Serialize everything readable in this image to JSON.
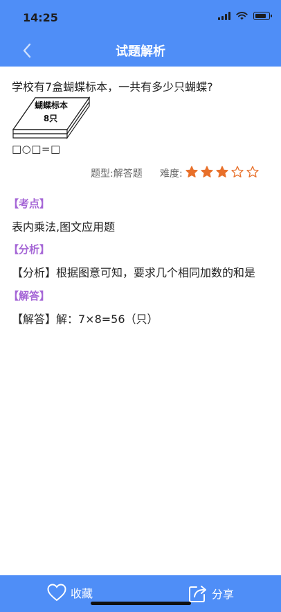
{
  "status_bar": {
    "time": "14:25"
  },
  "header": {
    "title": "试题解析"
  },
  "question": {
    "text": "学校有7盒蝴蝶标本，一共有多少只蝴蝶?",
    "image_text_line1": "蝴蝶标本",
    "image_text_line2": "8只",
    "equation": "□○□=□"
  },
  "meta": {
    "type_label": "题型:解答题",
    "difficulty_label": "难度:",
    "difficulty_rating": 3,
    "difficulty_max": 5,
    "star_color": "#e8702a"
  },
  "sections": {
    "kaodian_title": "【考点】",
    "kaodian_body": "表内乘法,图文应用题",
    "fenxi_title": "【分析】",
    "fenxi_body": "【分析】根据图意可知，要求几个相同加数的和是",
    "jieda_title": "【解答】",
    "jieda_body": "【解答】解：7×8=56（只）"
  },
  "bottom_bar": {
    "favorite_label": "收藏",
    "share_label": "分享"
  },
  "colors": {
    "primary": "#4f8ef7",
    "section_title": "#a566d6"
  }
}
